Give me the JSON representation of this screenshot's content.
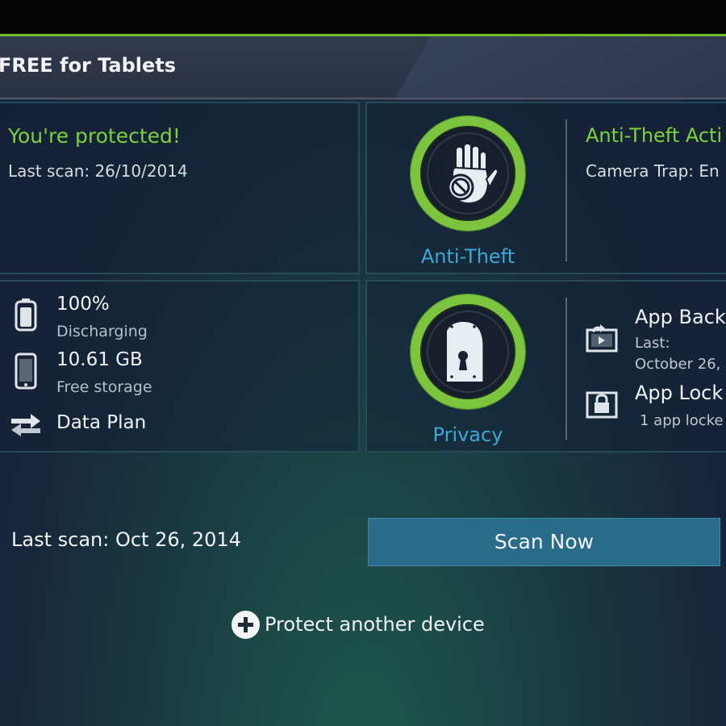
{
  "app": {
    "title": "FREE for Tablets"
  },
  "status": {
    "title": "You're protected!",
    "last_scan": "Last scan: 26/10/2014"
  },
  "anti_theft": {
    "label": "Anti-Theft",
    "status_title": "Anti-Theft Acti",
    "status_detail": "Camera Trap: En"
  },
  "device": {
    "battery_value": "100%",
    "battery_status": "Discharging",
    "storage_value": "10.61 GB",
    "storage_label": "Free storage",
    "data_plan_label": "Data Plan"
  },
  "privacy": {
    "label": "Privacy",
    "app_backup_title": "App Back",
    "app_backup_sub_1": "Last:",
    "app_backup_sub_2": "October 26,",
    "app_lock_title": "App Lock",
    "app_lock_sub": "1 app locke"
  },
  "footer": {
    "last_scan": "Last scan: Oct 26, 2014",
    "scan_button": "Scan Now",
    "protect_label": "Protect another device"
  },
  "colors": {
    "accent_green": "#7cd23c",
    "accent_blue": "#3ea7d6",
    "button": "#2a6b89"
  },
  "icons": [
    "hand-icon",
    "keyhole-lock-icon",
    "battery-icon",
    "phone-storage-icon",
    "data-transfer-icon",
    "app-backup-icon",
    "app-lock-icon",
    "plus-circle-icon"
  ]
}
